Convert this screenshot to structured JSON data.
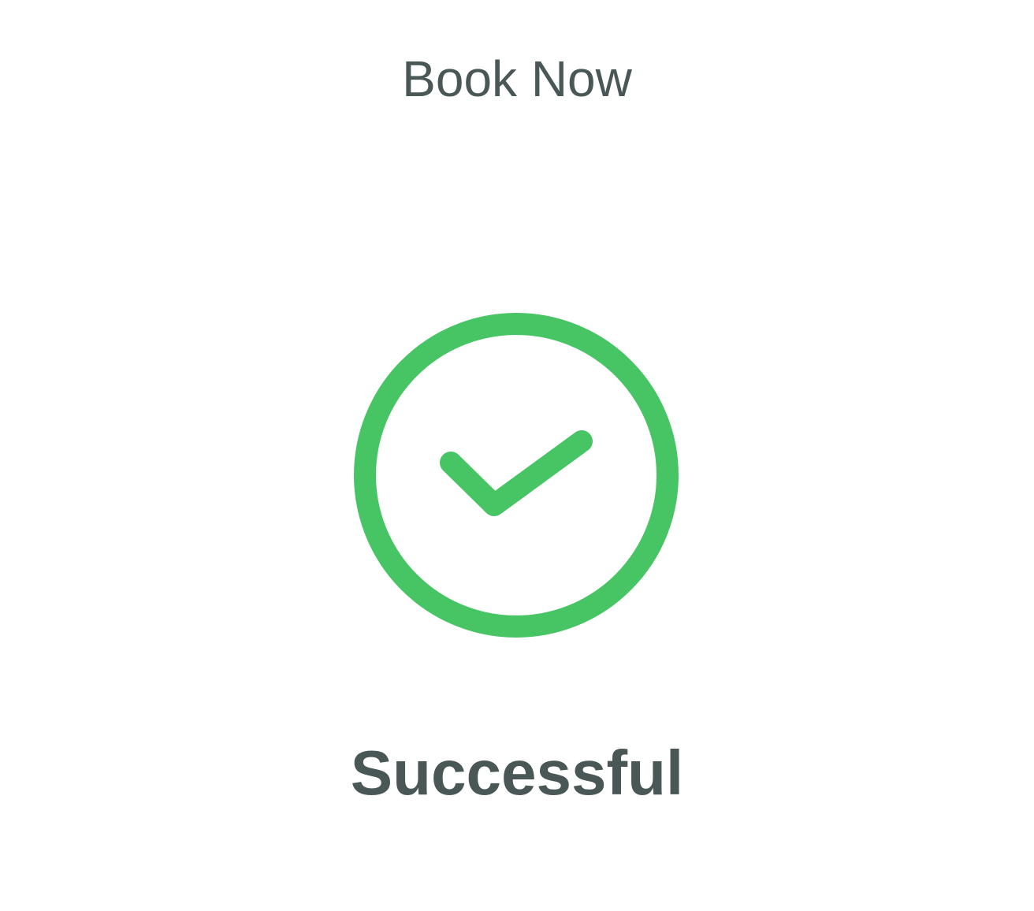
{
  "header": {
    "title": "Book Now"
  },
  "status": {
    "icon": "check-circle-icon",
    "text": "Successful",
    "accent_color": "#47c564",
    "text_color": "#4a5757"
  }
}
